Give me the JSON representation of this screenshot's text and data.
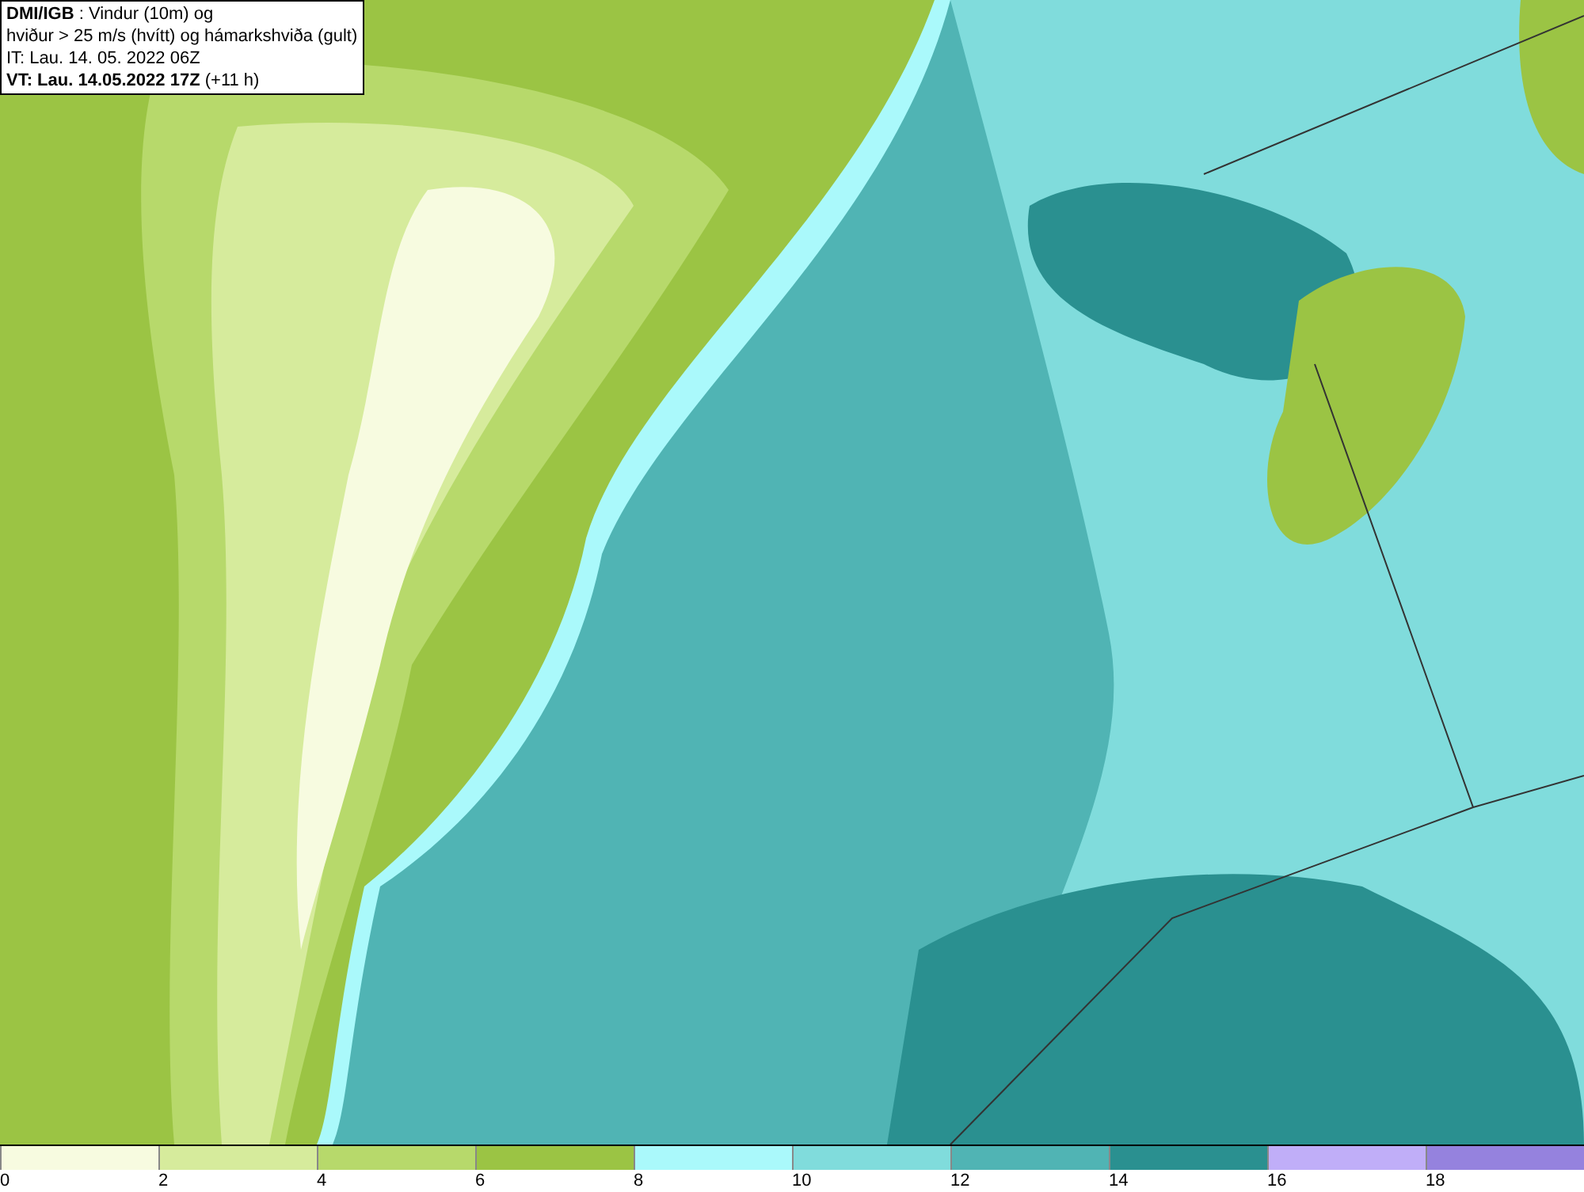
{
  "header": {
    "lines": [
      "**DMI/IGB** : Vindur (10m) og",
      "hviður > 25 m/s (hvítt) og hámarkshviða (gult)",
      "IT: Lau. 14. 05. 2022 06Z",
      "**VT: Lau. 14.05.2022 17Z** (+11 h)"
    ]
  },
  "legend": {
    "bins": [
      {
        "label": "0",
        "color": "#f7fbe0"
      },
      {
        "label": "2",
        "color": "#d6eb9c"
      },
      {
        "label": "4",
        "color": "#b7d96b"
      },
      {
        "label": "6",
        "color": "#9bc444"
      },
      {
        "label": "8",
        "color": "#aaf9fb"
      },
      {
        "label": "10",
        "color": "#80dcdc"
      },
      {
        "label": "12",
        "color": "#50b4b4"
      },
      {
        "label": "14",
        "color": "#2a9090"
      },
      {
        "label": "16",
        "color": "#c0aef8"
      },
      {
        "label": "18",
        "color": "#9582de"
      }
    ]
  }
}
